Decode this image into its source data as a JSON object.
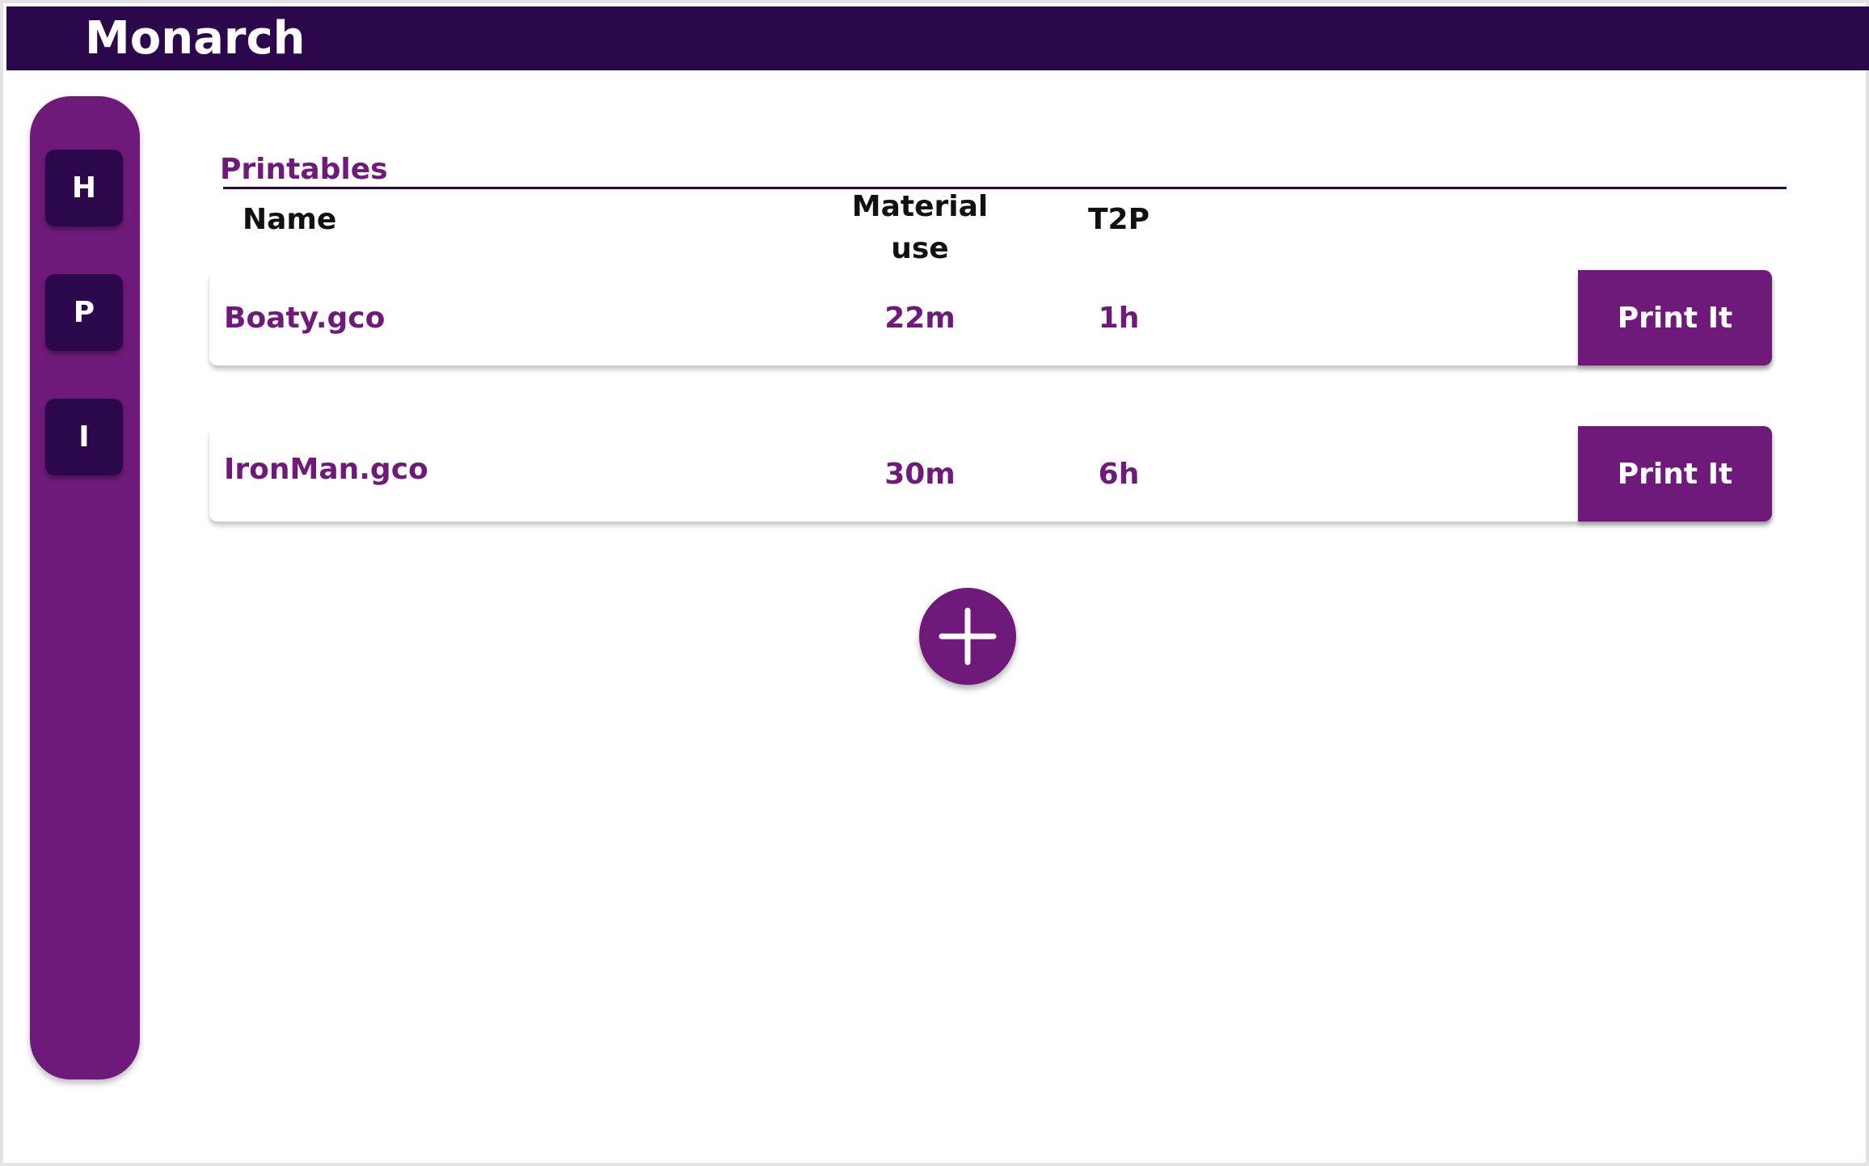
{
  "app": {
    "title": "Monarch"
  },
  "sidebar": {
    "items": [
      {
        "label": "H"
      },
      {
        "label": "P"
      },
      {
        "label": "I"
      }
    ]
  },
  "section": {
    "title": "Printables"
  },
  "table": {
    "headers": {
      "name": "Name",
      "material_line1": "Material",
      "material_line2": "use",
      "t2p": "T2P"
    },
    "rows": [
      {
        "name": "Boaty.gco",
        "material": "22m",
        "t2p": "1h",
        "action": "Print It"
      },
      {
        "name": "IronMan.gco",
        "material": "30m",
        "t2p": "6h",
        "action": "Print It"
      }
    ]
  },
  "add_button": {
    "icon": "plus-icon"
  },
  "colors": {
    "header": "#2c074c",
    "accent": "#6f1a7a",
    "background": "#ffffff"
  }
}
